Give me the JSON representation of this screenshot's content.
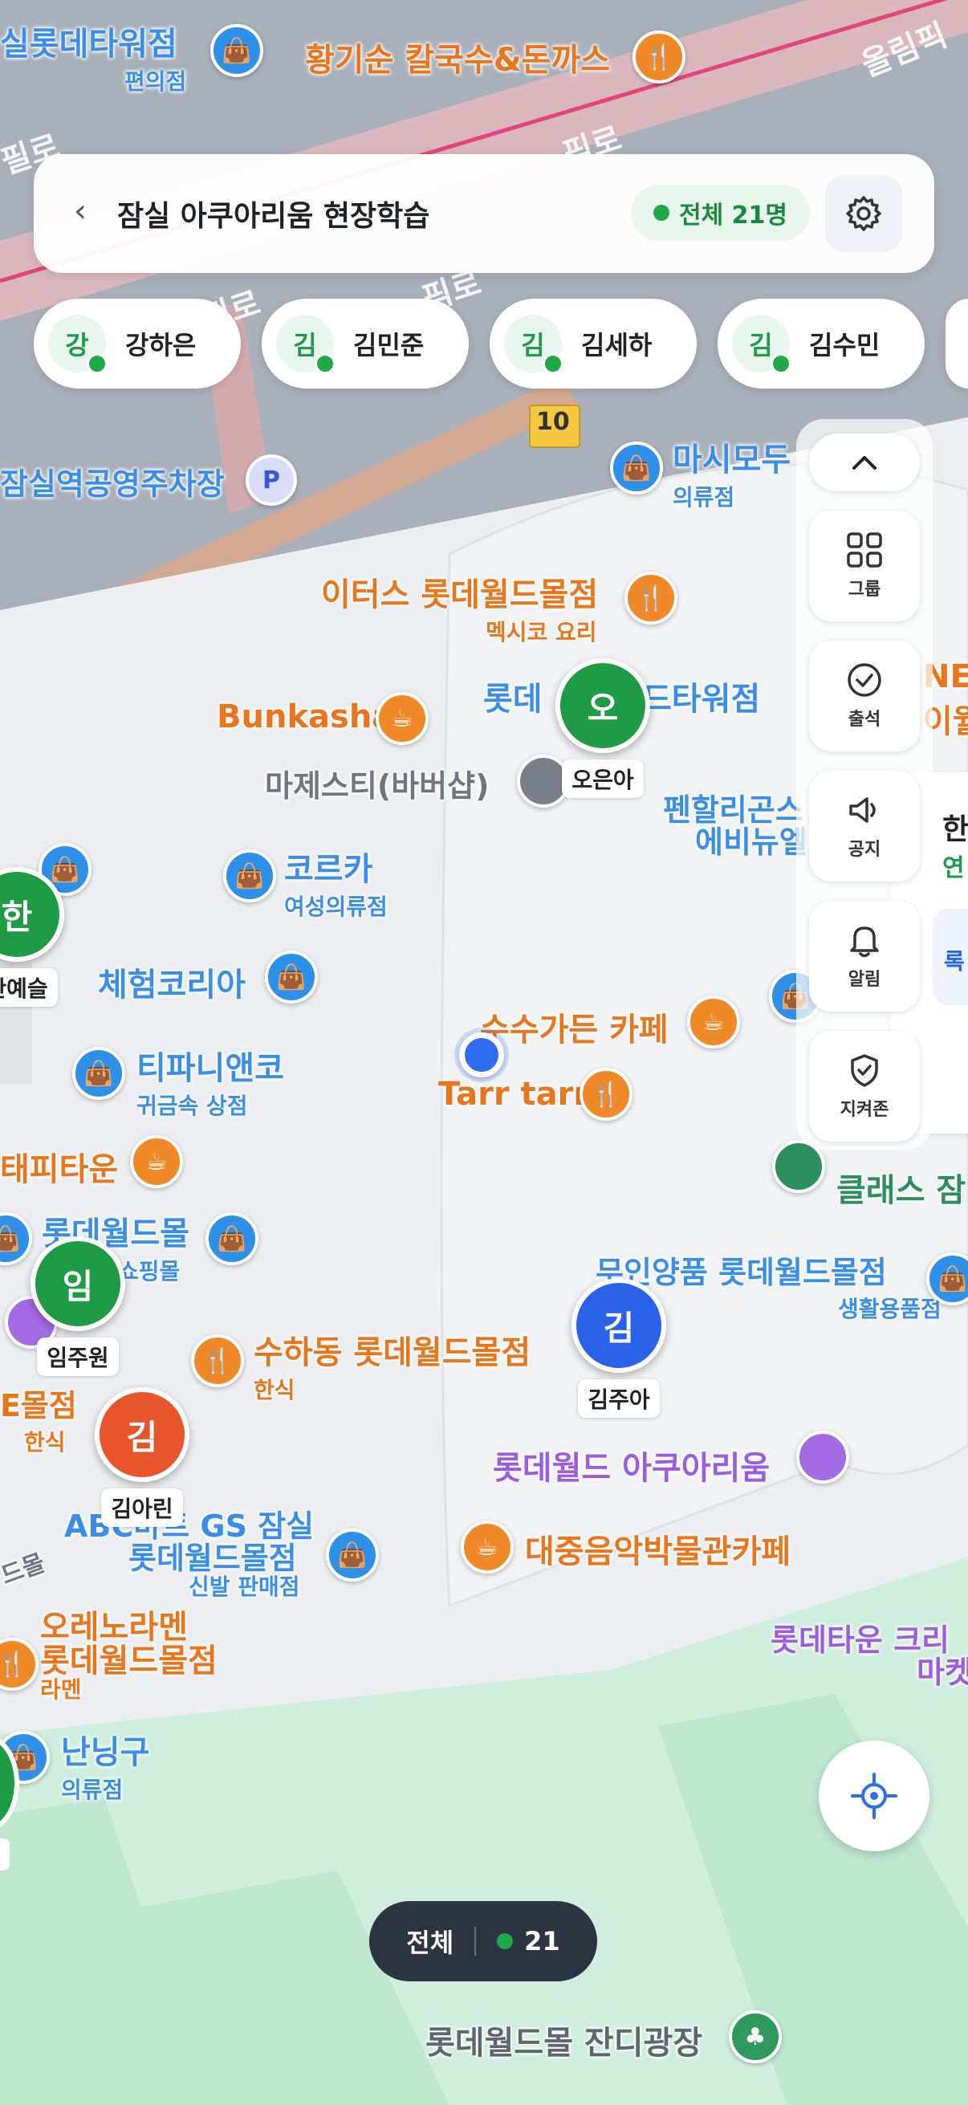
{
  "header": {
    "back_glyph": "‹",
    "title": "잠실 아쿠아리움 현장학습",
    "count_label": "전체 21명"
  },
  "students_chips": [
    {
      "initial": "강",
      "name": "강하은"
    },
    {
      "initial": "김",
      "name": "김민준"
    },
    {
      "initial": "김",
      "name": "김세하"
    },
    {
      "initial": "김",
      "name": "김수민"
    }
  ],
  "toolbar": {
    "group": "그룹",
    "attendance": "출석",
    "notice": "공지",
    "alert": "알림",
    "safezone": "지켜존"
  },
  "markers": [
    {
      "initial": "오",
      "name": "오은아",
      "color": "#1f9a45"
    },
    {
      "initial": "한",
      "name": "한예슬",
      "color": "#1f9a45"
    },
    {
      "initial": "임",
      "name": "임주원",
      "color": "#1f9a45"
    },
    {
      "initial": "김",
      "name": "김주아",
      "color": "#2a62e8"
    },
    {
      "initial": "김",
      "name": "김아린",
      "color": "#e9552b"
    }
  ],
  "side_card": {
    "title_char": "한",
    "sub_char": "연",
    "link_char": "록"
  },
  "map_labels": {
    "top1": "실롯데타워점",
    "top1_sub": "편의점",
    "top2": "황기순 칼국수&돈까스",
    "top3": "올림픽",
    "road1": "필로",
    "road2": "픽로",
    "road3": "픽로",
    "road4": "픽로",
    "road5": "픽로",
    "parking": "잠실역공영주차장",
    "road_no": "10",
    "m1": "마시모두",
    "m1_sub": "의류점",
    "m2": "이터스 롯데월드몰점",
    "m2_sub": "멕시코 요리",
    "m3": "롯데",
    "m3b": "드타워점",
    "m4": "Bunkasha",
    "m5": "마제스티(바버샵)",
    "m6": "펜할리곤스",
    "m6_sub": "에비뉴엘",
    "m7": "코르카",
    "m7_sub": "여성의류점",
    "m8": "체험코리아",
    "m9": "수수가든 카페",
    "m10": "티파니앤코",
    "m10_sub": "귀금속 상점",
    "m11": "Tarr tarr",
    "m12": "태피타운",
    "m13": "롯데월드몰",
    "m13_sub": "쇼핑몰",
    "m14": "무인양품 롯데월드몰점",
    "m14_sub": "생활용품점",
    "m15": "클래스 잠",
    "m16": "수하동 롯데월드몰점",
    "m16_sub": "한식",
    "m17": "롯데월드 아쿠아리움",
    "m18": "ABC마트 GS 잠실",
    "m18b": "롯데월드몰점",
    "m18_sub": "신발 판매점",
    "m19": "대중음악박물관카페",
    "m20": "오레노라멘",
    "m20b": "롯데월드몰점",
    "m20_sub": "라멘",
    "m21": "롯데타운 크리",
    "m21b": "마켓",
    "m22": "난닝구",
    "m22_sub": "의류점",
    "m23": "롯데월드몰 잔디광장",
    "m24": "E몰점",
    "m24_sub": "한식",
    "m25": "NE",
    "m25_sub": "이월",
    "m26": "드몰",
    "poi_eat": "🍴",
    "poi_cafe": "☕",
    "poi_shop": "👜",
    "poi_tree": "♣",
    "poi_p": "P"
  },
  "bottom": {
    "total_label": "전체",
    "total_count": "21"
  },
  "colors": {
    "accent_green": "#1eaa48",
    "dark_pill": "#2b3440",
    "park": "#cfeedd"
  },
  "icons": [
    "back-icon",
    "gear-icon",
    "chevron-up-icon",
    "grid-icon",
    "check-circle-icon",
    "megaphone-icon",
    "bell-icon",
    "shield-icon",
    "locate-icon"
  ]
}
